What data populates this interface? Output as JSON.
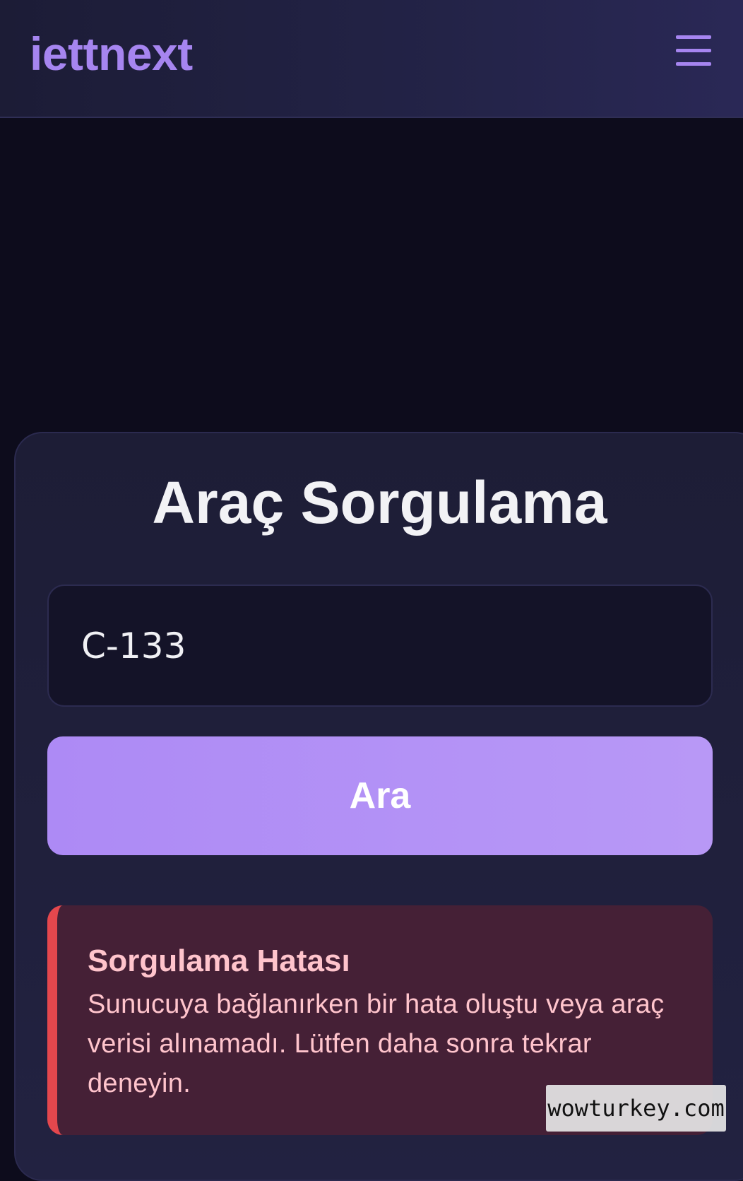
{
  "navbar": {
    "brand": "iettnext",
    "menu_icon": "hamburger-menu-icon"
  },
  "search_card": {
    "title": "Araç Sorgulama",
    "vehicle_input_value": "C-133",
    "search_button_label": "Ara"
  },
  "error": {
    "title": "Sorgulama Hatası",
    "message": "Sunucuya bağlanırken bir hata oluştu veya araç verisi alınamadı. Lütfen daha sonra tekrar deneyin."
  },
  "watermark": "wowturkey.com",
  "colors": {
    "accent": "#a685f0",
    "button": "#b090f5",
    "background": "#0d0c1c",
    "error_bar": "#e4474d",
    "error_bg": "#452036",
    "error_text": "#ffc4cc"
  }
}
